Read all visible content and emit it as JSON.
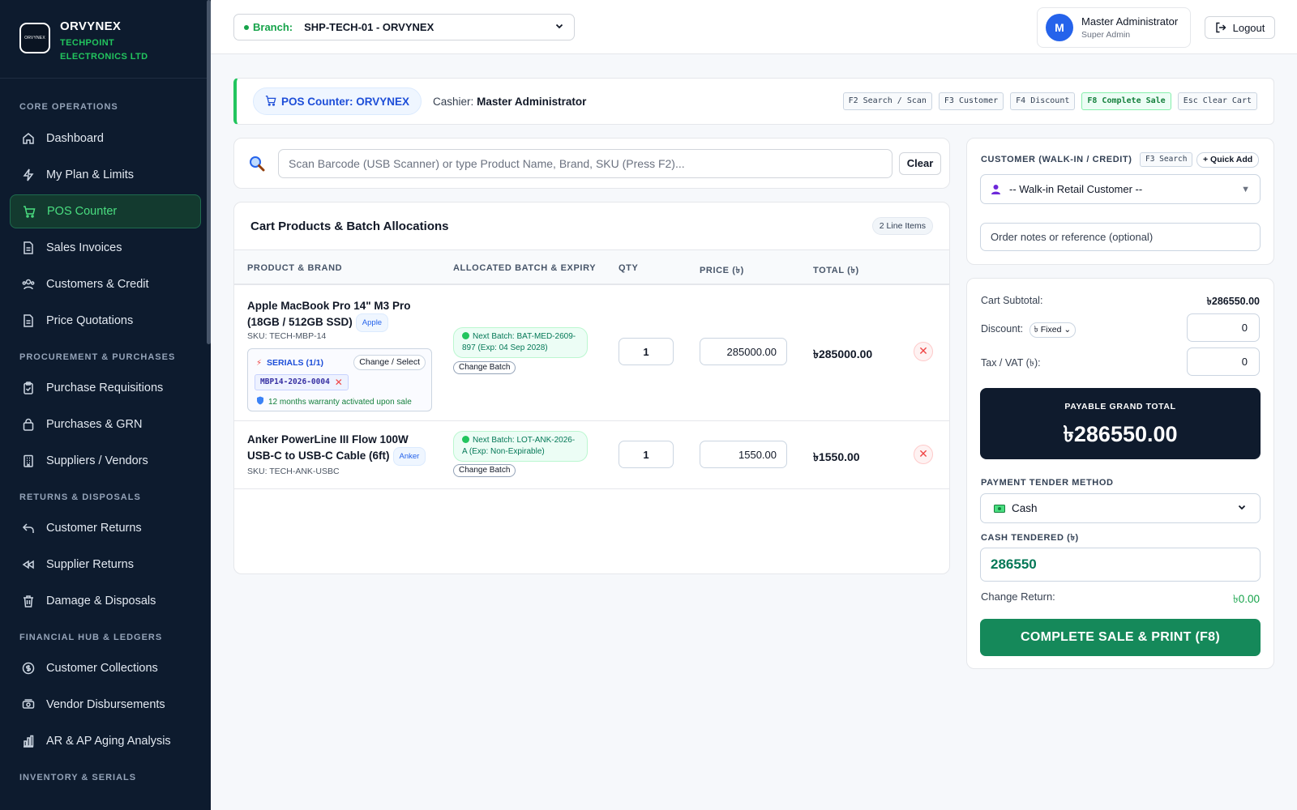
{
  "brand": {
    "logo_text": "ORVYNEX",
    "name": "ORVYNEX",
    "subtitle": "TECHPOINT ELECTRONICS LTD"
  },
  "sidebar": {
    "sections": [
      {
        "label": "CORE OPERATIONS",
        "items": [
          {
            "label": "Dashboard",
            "icon": "home-icon"
          },
          {
            "label": "My Plan & Limits",
            "icon": "bolt-icon"
          },
          {
            "label": "POS Counter",
            "icon": "cart-icon",
            "active": true
          },
          {
            "label": "Sales Invoices",
            "icon": "document-icon"
          },
          {
            "label": "Customers & Credit",
            "icon": "users-icon"
          },
          {
            "label": "Price Quotations",
            "icon": "document-icon"
          }
        ]
      },
      {
        "label": "PROCUREMENT & PURCHASES",
        "items": [
          {
            "label": "Purchase Requisitions",
            "icon": "clipboard-icon"
          },
          {
            "label": "Purchases & GRN",
            "icon": "bag-icon"
          },
          {
            "label": "Suppliers / Vendors",
            "icon": "building-icon"
          }
        ]
      },
      {
        "label": "RETURNS & DISPOSALS",
        "items": [
          {
            "label": "Customer Returns",
            "icon": "undo-icon"
          },
          {
            "label": "Supplier Returns",
            "icon": "rewind-icon"
          },
          {
            "label": "Damage & Disposals",
            "icon": "trash-icon"
          }
        ]
      },
      {
        "label": "FINANCIAL HUB & LEDGERS",
        "items": [
          {
            "label": "Customer Collections",
            "icon": "coin-icon"
          },
          {
            "label": "Vendor Disbursements",
            "icon": "cash-icon"
          },
          {
            "label": "AR & AP Aging Analysis",
            "icon": "bar-chart-icon"
          }
        ]
      },
      {
        "label": "INVENTORY & SERIALS",
        "items": []
      }
    ]
  },
  "header": {
    "branch_label": "Branch:",
    "branch_value": "SHP-TECH-01 - ORVYNEX",
    "user_initial": "M",
    "user_name": "Master Administrator",
    "user_role": "Super Admin",
    "logout_label": "Logout"
  },
  "counter": {
    "title": "POS Counter: ORVYNEX",
    "cashier_label": "Cashier:",
    "cashier_name": "Master Administrator",
    "shortcuts": [
      "F2 Search / Scan",
      "F3 Customer",
      "F4 Discount",
      "F8 Complete Sale",
      "Esc Clear Cart"
    ]
  },
  "search": {
    "placeholder": "Scan Barcode (USB Scanner) or type Product Name, Brand, SKU (Press F2)...",
    "clear_label": "Clear"
  },
  "cart": {
    "title": "Cart Products & Batch Allocations",
    "line_items_badge": "2 Line Items",
    "columns": [
      "PRODUCT & BRAND",
      "ALLOCATED BATCH & EXPIRY",
      "QTY",
      "PRICE (৳)",
      "TOTAL (৳)"
    ],
    "rows": [
      {
        "name": "Apple MacBook Pro 14\" M3 Pro (18GB / 512GB SSD)",
        "brand": "Apple",
        "sku": "SKU: TECH-MBP-14",
        "serials_title": "SERIALS (1/1)",
        "change_select_label": "Change / Select",
        "serial": "MBP14-2026-0004",
        "warranty": "12 months warranty activated upon sale",
        "batch": "Next Batch: BAT-MED-2609-897 (Exp: 04 Sep 2028)",
        "change_batch_label": "Change Batch",
        "qty": "1",
        "price": "285000.00",
        "total": "৳285000.00"
      },
      {
        "name": "Anker PowerLine III Flow 100W USB-C to USB-C Cable (6ft)",
        "brand": "Anker",
        "sku": "SKU: TECH-ANK-USBC",
        "batch": "Next Batch: LOT-ANK-2026-A (Exp: Non-Expirable)",
        "change_batch_label": "Change Batch",
        "qty": "1",
        "price": "1550.00",
        "total": "৳1550.00"
      }
    ]
  },
  "customer": {
    "label": "CUSTOMER (WALK-IN / CREDIT)",
    "f3_search": "F3 Search",
    "quick_add": "+ Quick Add",
    "selected": "-- Walk-in Retail Customer --",
    "notes_placeholder": "Order notes or reference (optional)"
  },
  "payment": {
    "subtotal_label": "Cart Subtotal:",
    "subtotal_value": "৳286550.00",
    "discount_label": "Discount:",
    "discount_type": "৳ Fixed",
    "discount_value": "0",
    "tax_label": "Tax / VAT (৳):",
    "tax_value": "0",
    "grand_label": "PAYABLE GRAND TOTAL",
    "grand_value": "৳286550.00",
    "tender_label": "PAYMENT TENDER METHOD",
    "tender_value": "Cash",
    "cash_label": "CASH TENDERED (৳)",
    "cash_value": "286550",
    "change_label": "Change Return:",
    "change_value": "৳0.00",
    "complete_label": "COMPLETE SALE & PRINT (F8)"
  },
  "colors": {
    "sidebar_bg": "#0d1b2e",
    "accent_green": "#15895a",
    "primary_blue": "#2563eb"
  }
}
